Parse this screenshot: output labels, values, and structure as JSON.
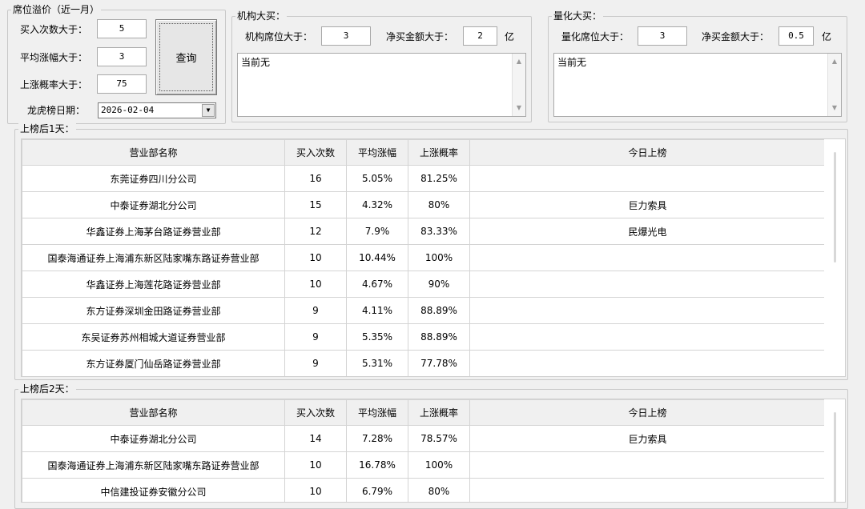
{
  "seat_premium": {
    "legend": "席位溢价（近一月）",
    "buy_count_label": "买入次数大于：",
    "buy_count_value": "5",
    "avg_gain_label": "平均涨幅大于：",
    "avg_gain_value": "3",
    "rise_prob_label": "上涨概率大于：",
    "rise_prob_value": "75",
    "query_button": "查询",
    "date_label": "龙虎榜日期：",
    "date_value": "2026-02-04"
  },
  "institution": {
    "legend": "机构大买：",
    "seat_label": "机构席位大于：",
    "seat_value": "3",
    "amount_label": "净买金额大于：",
    "amount_value": "2",
    "amount_unit": "亿",
    "result_text": "当前无"
  },
  "quant": {
    "legend": "量化大买：",
    "seat_label": "量化席位大于：",
    "seat_value": "3",
    "amount_label": "净买金额大于：",
    "amount_value": "0.5",
    "amount_unit": "亿",
    "result_text": "当前无"
  },
  "columns": [
    "营业部名称",
    "买入次数",
    "平均涨幅",
    "上涨概率",
    "今日上榜"
  ],
  "day1": {
    "legend": "上榜后1天：",
    "rows": [
      [
        "东莞证券四川分公司",
        "16",
        "5.05%",
        "81.25%",
        ""
      ],
      [
        "中泰证券湖北分公司",
        "15",
        "4.32%",
        "80%",
        "巨力索具"
      ],
      [
        "华鑫证券上海茅台路证券营业部",
        "12",
        "7.9%",
        "83.33%",
        "民爆光电"
      ],
      [
        "国泰海通证券上海浦东新区陆家嘴东路证券营业部",
        "10",
        "10.44%",
        "100%",
        ""
      ],
      [
        "华鑫证券上海莲花路证券营业部",
        "10",
        "4.67%",
        "90%",
        ""
      ],
      [
        "东方证券深圳金田路证券营业部",
        "9",
        "4.11%",
        "88.89%",
        ""
      ],
      [
        "东吴证券苏州相城大道证券营业部",
        "9",
        "5.35%",
        "88.89%",
        ""
      ],
      [
        "东方证券厦门仙岳路证券营业部",
        "9",
        "5.31%",
        "77.78%",
        ""
      ]
    ]
  },
  "day2": {
    "legend": "上榜后2天：",
    "rows": [
      [
        "中泰证券湖北分公司",
        "14",
        "7.28%",
        "78.57%",
        "巨力索具"
      ],
      [
        "国泰海通证券上海浦东新区陆家嘴东路证券营业部",
        "10",
        "16.78%",
        "100%",
        ""
      ],
      [
        "中信建投证券安徽分公司",
        "10",
        "6.79%",
        "80%",
        ""
      ]
    ]
  }
}
